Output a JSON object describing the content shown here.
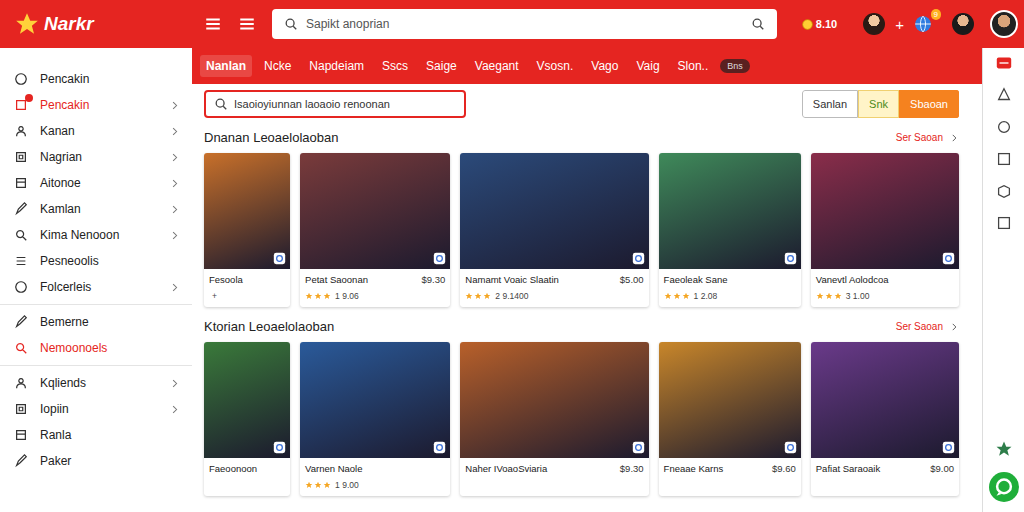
{
  "header": {
    "logo": "Narkr",
    "search_placeholder": "Sapikt anoprian",
    "balance": "8.10",
    "plus": "+",
    "notification_badge": "9"
  },
  "sidebar": {
    "groups": [
      [
        {
          "label": "Pencakin",
          "chevron": false,
          "selected": false,
          "dot": false
        },
        {
          "label": "Pencakin",
          "chevron": true,
          "selected": true,
          "dot": true
        },
        {
          "label": "Kanan",
          "chevron": true,
          "selected": false,
          "dot": false
        },
        {
          "label": "Nagrian",
          "chevron": true,
          "selected": false,
          "dot": false
        },
        {
          "label": "Aitonoe",
          "chevron": true,
          "selected": false,
          "dot": false
        },
        {
          "label": "Kamlan",
          "chevron": true,
          "selected": false,
          "dot": false
        },
        {
          "label": "Kima Nenooon",
          "chevron": true,
          "selected": false,
          "dot": false
        },
        {
          "label": "Pesneoolis",
          "chevron": false,
          "selected": false,
          "dot": false
        },
        {
          "label": "Folcerleis",
          "chevron": true,
          "selected": false,
          "dot": false
        }
      ],
      [
        {
          "label": "Bemerne",
          "chevron": false,
          "selected": false,
          "dot": false
        },
        {
          "label": "Nemoonoels",
          "chevron": false,
          "selected": true,
          "dot": false
        }
      ],
      [
        {
          "label": "Kqliends",
          "chevron": true,
          "selected": false,
          "dot": false
        },
        {
          "label": "Iopiin",
          "chevron": true,
          "selected": false,
          "dot": false
        },
        {
          "label": "Ranla",
          "chevron": false,
          "selected": false,
          "dot": false
        },
        {
          "label": "Paker",
          "chevron": false,
          "selected": false,
          "dot": false
        }
      ]
    ]
  },
  "tabs": [
    {
      "label": "Nanlan",
      "selected": true
    },
    {
      "label": "Ncke",
      "selected": false
    },
    {
      "label": "Napdeiam",
      "selected": false
    },
    {
      "label": "Sscs",
      "selected": false
    },
    {
      "label": "Saige",
      "selected": false
    },
    {
      "label": "Vaegant",
      "selected": false
    },
    {
      "label": "Vsosn.",
      "selected": false
    },
    {
      "label": "Vago",
      "selected": false
    },
    {
      "label": "Vaig",
      "selected": false
    },
    {
      "label": "Slon..",
      "selected": false
    }
  ],
  "tab_pill": "Bns",
  "filter": {
    "placeholder": "Isaoioyiunnan laoaoio renoonan",
    "buttons": [
      {
        "label": "Sanlan",
        "kind": "outline"
      },
      {
        "label": "Snk",
        "kind": "soft"
      },
      {
        "label": "Sbaoan",
        "kind": "primary"
      }
    ]
  },
  "sections": [
    {
      "title": "Dnanan Leoaelolaoban",
      "link": "Ser Saoan",
      "cards": [
        {
          "title": "Fesoola",
          "price": "",
          "stars": 0,
          "reviews": "+",
          "color": "#c8702a"
        },
        {
          "title": "Petat Saoonan",
          "price": "$9.30",
          "stars": 3,
          "reviews": "1 9.06",
          "color": "#7a3b3b"
        },
        {
          "title": "Namamt Voaic Slaatin",
          "price": "$5.00",
          "stars": 3,
          "reviews": "2 9.1400",
          "color": "#2b4a7a"
        },
        {
          "title": "Faeoleak Sane",
          "price": "",
          "stars": 3,
          "reviews": "1 2.08",
          "color": "#3f8a5a"
        },
        {
          "title": "Vanevtl Aolodcoa",
          "price": "",
          "stars": 3,
          "reviews": "3 1.00",
          "color": "#8a2d4a"
        }
      ]
    },
    {
      "title": "Ktorian Leoaelolaoban",
      "link": "Ser Saoan",
      "cards": [
        {
          "title": "Faeoonoon",
          "price": "",
          "stars": 0,
          "reviews": "",
          "color": "#3a7a3a"
        },
        {
          "title": "Varnen Naole",
          "price": "",
          "stars": 3,
          "reviews": "1 9.00",
          "color": "#2a5a9a"
        },
        {
          "title": "Naher IVoaoSviaria",
          "price": "$9.30",
          "stars": 0,
          "reviews": "",
          "color": "#b8602a"
        },
        {
          "title": "Fneaae Karns",
          "price": "$9.60",
          "stars": 0,
          "reviews": "",
          "color": "#c8862a"
        },
        {
          "title": "Pafiat Saraoaik",
          "price": "$9.00",
          "stars": 0,
          "reviews": "",
          "color": "#6a3a8a"
        }
      ]
    }
  ]
}
